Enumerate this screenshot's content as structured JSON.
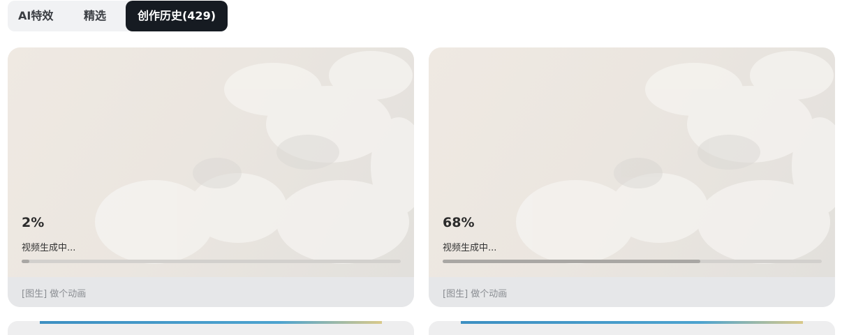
{
  "tabs": {
    "ai_effects": "AI特效",
    "picks": "精选",
    "history": "创作历史(429)"
  },
  "cards": [
    {
      "percent": "2%",
      "progress_fraction": 0.02,
      "status": "视频生成中...",
      "prompt": "[图生] 做个动画"
    },
    {
      "percent": "68%",
      "progress_fraction": 0.68,
      "status": "视频生成中...",
      "prompt": "[图生] 做个动画"
    }
  ],
  "colors": {
    "active_tab_bg": "#161b22",
    "progress_fill": "#a9a7a4",
    "progress_track": "#d2d0cd"
  }
}
